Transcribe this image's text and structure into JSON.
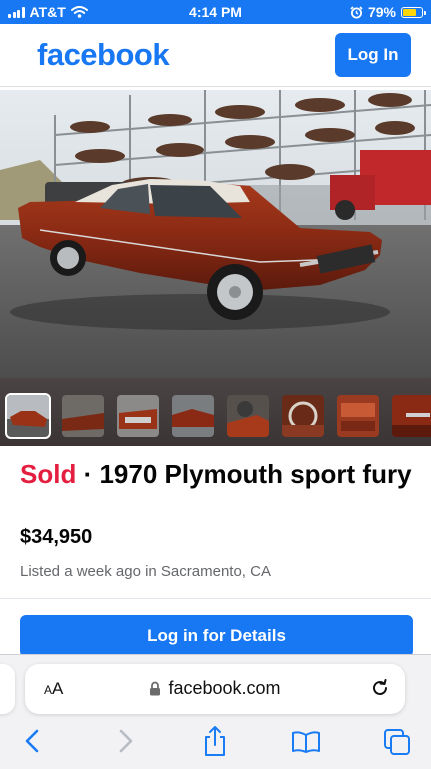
{
  "status_bar": {
    "carrier": "AT&T",
    "time": "4:14 PM",
    "battery": "79%",
    "battery_level": 0.79
  },
  "header": {
    "logo": "facebook",
    "login_label": "Log In"
  },
  "photo": {
    "thumbnail_count": 8,
    "active_thumbnail": 0
  },
  "listing": {
    "status": "Sold",
    "separator": " · ",
    "title": "1970 Plymouth sport fury",
    "price": "$34,950",
    "listed_info": "Listed a week ago in Sacramento, CA",
    "details_button": "Log in for Details"
  },
  "browser": {
    "text_size_label": "AA",
    "url": "facebook.com"
  },
  "colors": {
    "brand": "#1877f2",
    "sold": "#e41e3f",
    "car_body": "#8a2a14"
  },
  "icons": [
    "wifi-icon",
    "alarm-icon",
    "lock-icon",
    "reload-icon",
    "back-icon",
    "forward-icon",
    "share-icon",
    "bookmarks-icon",
    "tabs-icon"
  ]
}
